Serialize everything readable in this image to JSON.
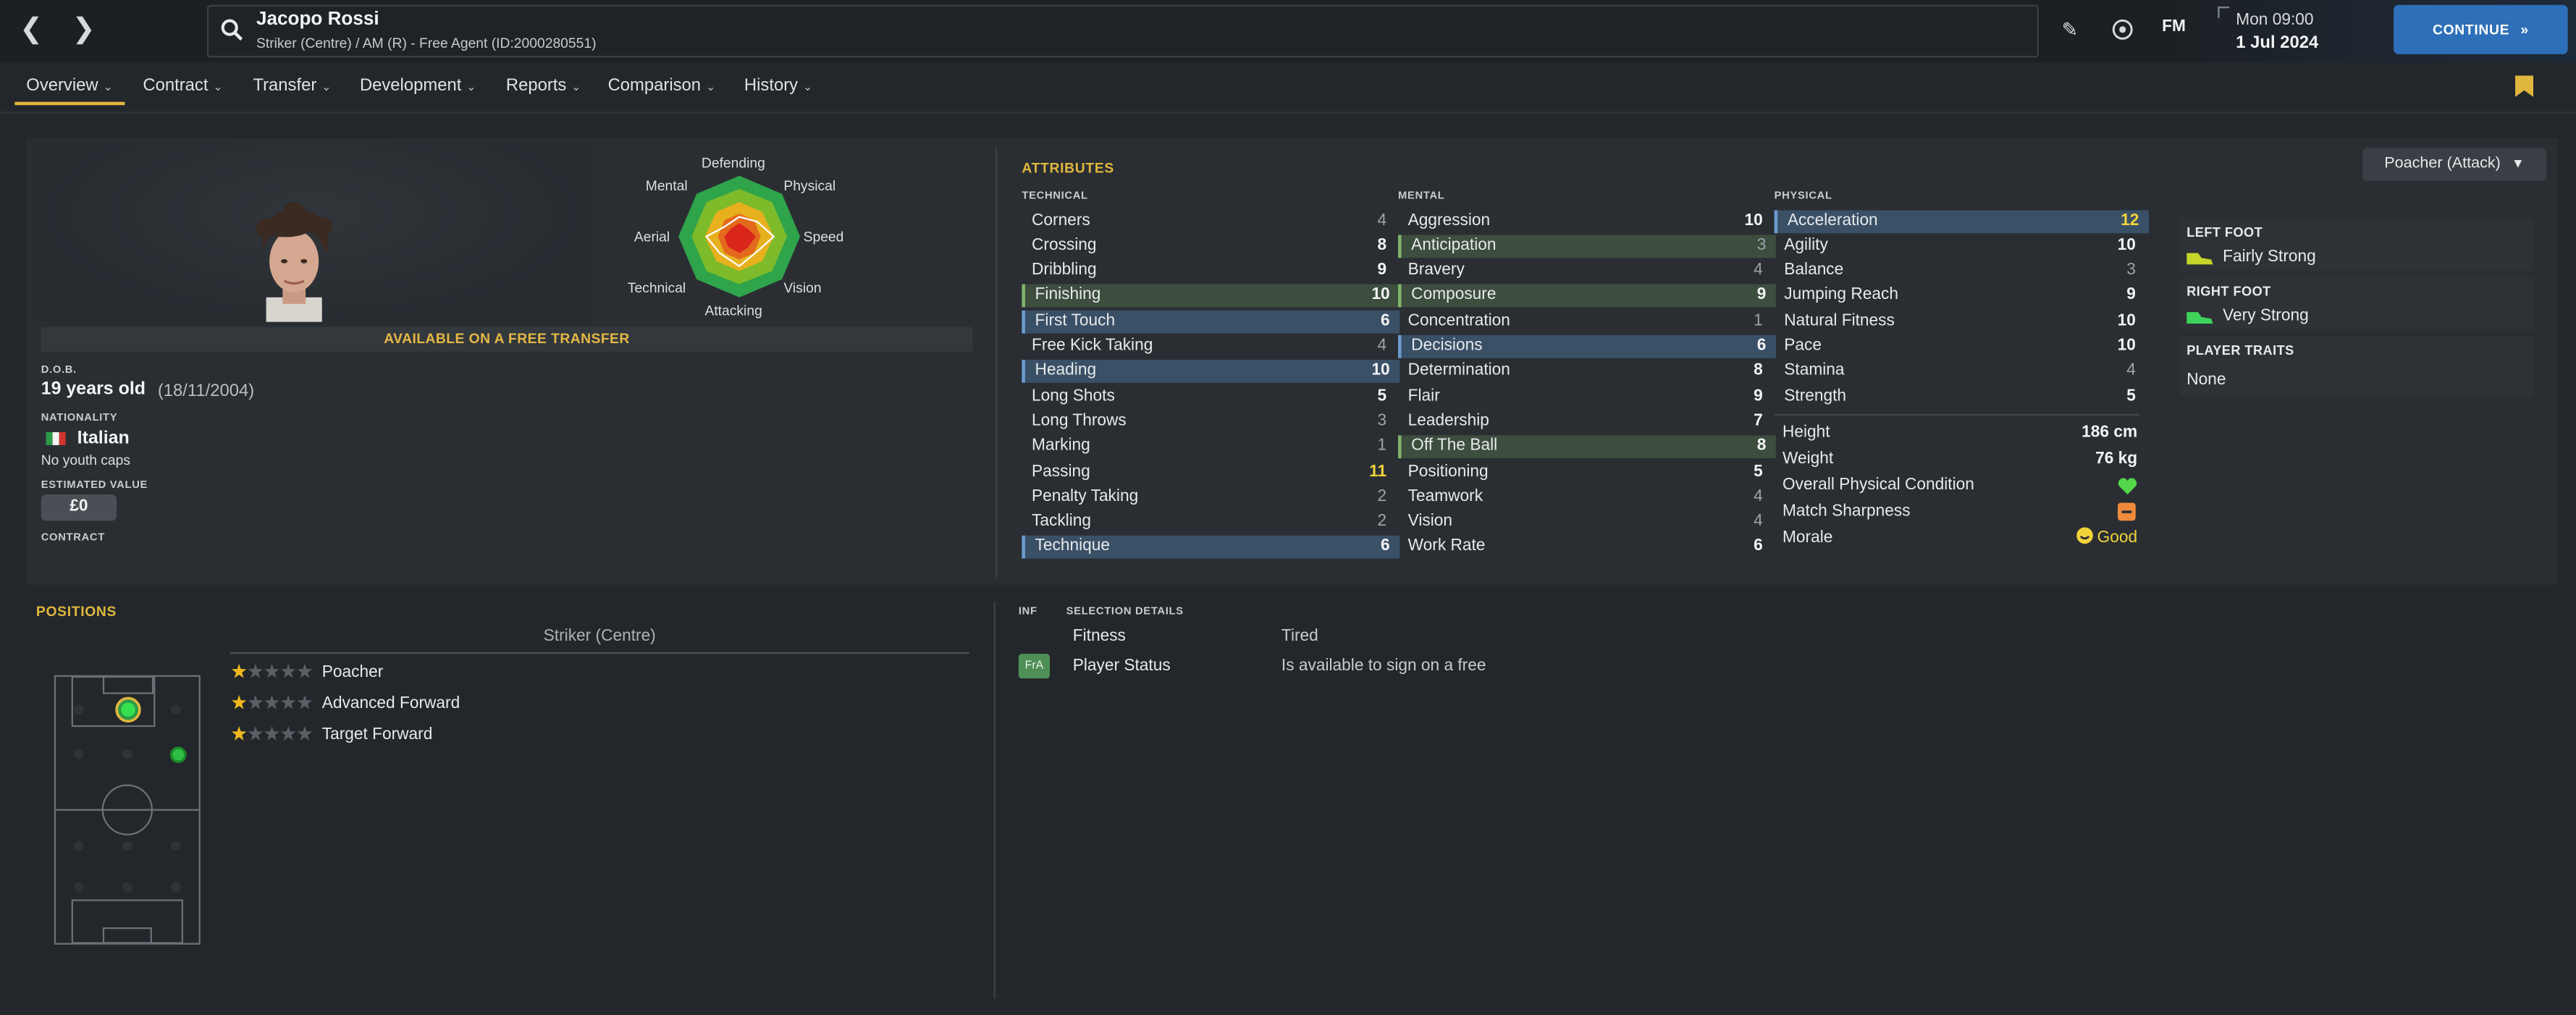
{
  "header": {
    "player_name": "Jacopo Rossi",
    "player_subtitle": "Striker (Centre) / AM (R) - Free Agent (ID:2000280551)",
    "fm_label": "FM",
    "date_time": "Mon 09:00",
    "date_day": "1 Jul 2024",
    "continue_label": "CONTINUE",
    "accent_color": "#2d6fb8"
  },
  "tabs": [
    {
      "label": "Overview"
    },
    {
      "label": "Contract"
    },
    {
      "label": "Transfer"
    },
    {
      "label": "Development"
    },
    {
      "label": "Reports"
    },
    {
      "label": "Comparison"
    },
    {
      "label": "History"
    }
  ],
  "overview": {
    "radar": {
      "labels": {
        "defending": "Defending",
        "physical": "Physical",
        "speed": "Speed",
        "vision": "Vision",
        "attacking": "Attacking",
        "technical": "Technical",
        "aerial": "Aerial",
        "mental": "Mental"
      }
    },
    "free_transfer_banner": "AVAILABLE ON A FREE TRANSFER",
    "dob_label": "D.O.B.",
    "age": "19 years old",
    "dob": "(18/11/2004)",
    "nationality_label": "NATIONALITY",
    "nationality": "Italian",
    "youth_caps": "No youth caps",
    "estimated_value_label": "ESTIMATED VALUE",
    "estimated_value": "£0",
    "contract_label": "CONTRACT"
  },
  "attributes": {
    "title": "ATTRIBUTES",
    "role": "Poacher (Attack)",
    "technical_label": "TECHNICAL",
    "mental_label": "MENTAL",
    "physical_label": "PHYSICAL",
    "technical": [
      {
        "name": "Corners",
        "value": "4",
        "hl": ""
      },
      {
        "name": "Crossing",
        "value": "8",
        "hl": ""
      },
      {
        "name": "Dribbling",
        "value": "9",
        "hl": ""
      },
      {
        "name": "Finishing",
        "value": "10",
        "hl": "green"
      },
      {
        "name": "First Touch",
        "value": "6",
        "hl": "blue"
      },
      {
        "name": "Free Kick Taking",
        "value": "4",
        "hl": ""
      },
      {
        "name": "Heading",
        "value": "10",
        "hl": "blue"
      },
      {
        "name": "Long Shots",
        "value": "5",
        "hl": ""
      },
      {
        "name": "Long Throws",
        "value": "3",
        "hl": ""
      },
      {
        "name": "Marking",
        "value": "1",
        "hl": ""
      },
      {
        "name": "Passing",
        "value": "11",
        "hl": ""
      },
      {
        "name": "Penalty Taking",
        "value": "2",
        "hl": ""
      },
      {
        "name": "Tackling",
        "value": "2",
        "hl": ""
      },
      {
        "name": "Technique",
        "value": "6",
        "hl": "blue"
      }
    ],
    "mental": [
      {
        "name": "Aggression",
        "value": "10",
        "hl": ""
      },
      {
        "name": "Anticipation",
        "value": "3",
        "hl": "green"
      },
      {
        "name": "Bravery",
        "value": "4",
        "hl": ""
      },
      {
        "name": "Composure",
        "value": "9",
        "hl": "green"
      },
      {
        "name": "Concentration",
        "value": "1",
        "hl": ""
      },
      {
        "name": "Decisions",
        "value": "6",
        "hl": "blue"
      },
      {
        "name": "Determination",
        "value": "8",
        "hl": ""
      },
      {
        "name": "Flair",
        "value": "9",
        "hl": ""
      },
      {
        "name": "Leadership",
        "value": "7",
        "hl": ""
      },
      {
        "name": "Off The Ball",
        "value": "8",
        "hl": "green"
      },
      {
        "name": "Positioning",
        "value": "5",
        "hl": ""
      },
      {
        "name": "Teamwork",
        "value": "4",
        "hl": ""
      },
      {
        "name": "Vision",
        "value": "4",
        "hl": ""
      },
      {
        "name": "Work Rate",
        "value": "6",
        "hl": ""
      }
    ],
    "physical": [
      {
        "name": "Acceleration",
        "value": "12",
        "hl": "blue"
      },
      {
        "name": "Agility",
        "value": "10",
        "hl": ""
      },
      {
        "name": "Balance",
        "value": "3",
        "hl": ""
      },
      {
        "name": "Jumping Reach",
        "value": "9",
        "hl": ""
      },
      {
        "name": "Natural Fitness",
        "value": "10",
        "hl": ""
      },
      {
        "name": "Pace",
        "value": "10",
        "hl": ""
      },
      {
        "name": "Stamina",
        "value": "4",
        "hl": ""
      },
      {
        "name": "Strength",
        "value": "5",
        "hl": ""
      }
    ],
    "physical_info": {
      "height_label": "Height",
      "height": "186 cm",
      "weight_label": "Weight",
      "weight": "76 kg",
      "condition_label": "Overall Physical Condition",
      "sharpness_label": "Match Sharpness",
      "morale_label": "Morale",
      "morale": "Good"
    }
  },
  "feet": {
    "left_label": "LEFT FOOT",
    "left_value": "Fairly Strong",
    "right_label": "RIGHT FOOT",
    "right_value": "Very Strong",
    "traits_label": "PLAYER TRAITS",
    "traits_value": "None"
  },
  "positions": {
    "title": "POSITIONS",
    "current_position": "Striker (Centre)",
    "roles": [
      {
        "name": "Poacher",
        "stars": 1
      },
      {
        "name": "Advanced Forward",
        "stars": 1
      },
      {
        "name": "Target Forward",
        "stars": 1
      }
    ]
  },
  "selection": {
    "inf_label": "INF",
    "details_label": "SELECTION DETAILS",
    "rows": [
      {
        "label": "Fitness",
        "value": "Tired",
        "badge": ""
      },
      {
        "label": "Player Status",
        "value": "Is available to sign on a free",
        "badge": "FrA"
      }
    ]
  },
  "colors": {
    "accent_yellow": "#e0b73e",
    "highlight_blue": "#3a5066",
    "highlight_green": "#3d4d3e",
    "value_yellow": "#f1d33a"
  }
}
